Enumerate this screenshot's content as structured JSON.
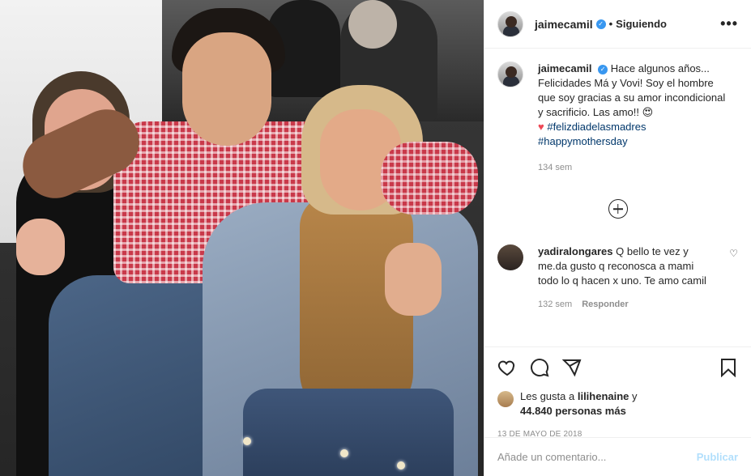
{
  "post": {
    "username": "jaimecamil",
    "verified_glyph": "✓",
    "following": "Siguiendo",
    "separator": "•",
    "more_glyph": "•••"
  },
  "caption": {
    "username": "jaimecamil",
    "text": "Hace algunos años... Felicidades Má y Vovi! Soy el hombre que soy gracias a su amor incondicional y sacrificio. Las amo!! 😍",
    "heart": "♥",
    "hashtag1": "#felizdiadelasmadres",
    "hashtag2": "#happymothersday",
    "age": "134 sem"
  },
  "comment": {
    "username": "yadiralongares",
    "text": "Q bello te vez y me.da gusto q reconosca a mami todo lo q hacen x uno. Te amo camil",
    "age": "132 sem",
    "reply": "Responder",
    "heart": "♡"
  },
  "likes": {
    "prefix": "Les gusta a",
    "user": "lilihenaine",
    "connector": "y",
    "count": "44.840 personas más"
  },
  "date": "13 DE MAYO DE 2018",
  "add_comment": {
    "placeholder": "Añade un comentario...",
    "publish": "Publicar"
  },
  "icons": [
    "heart-icon",
    "comment-icon",
    "share-icon",
    "bookmark-icon",
    "more-icon",
    "add-icon",
    "verified-icon"
  ]
}
